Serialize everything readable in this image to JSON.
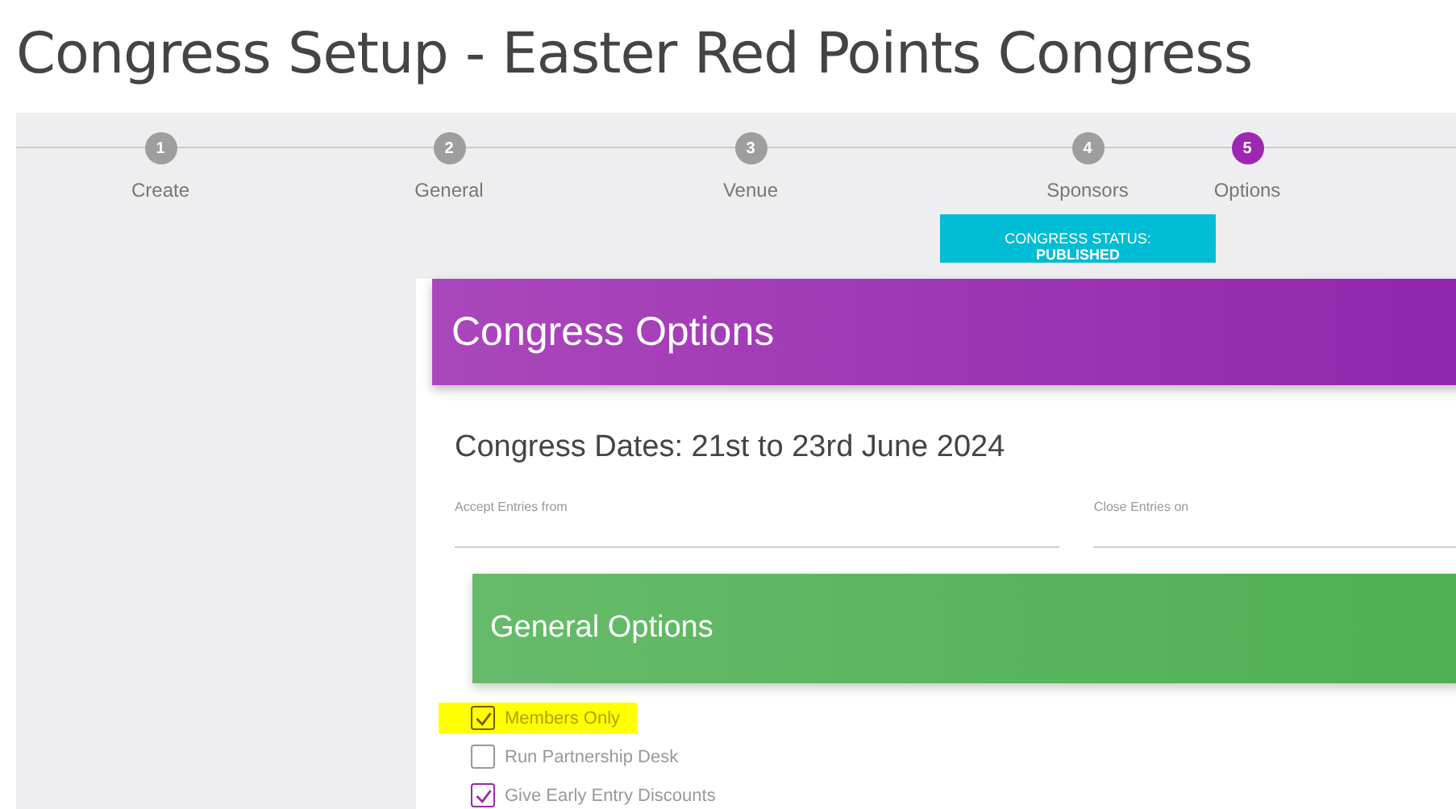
{
  "page_title": "Congress Setup - Easter Red Points Congress",
  "steps": [
    {
      "number": "1",
      "label": "Create",
      "selected": false
    },
    {
      "number": "2",
      "label": "General",
      "selected": false
    },
    {
      "number": "3",
      "label": "Venue",
      "selected": false
    },
    {
      "number": "4",
      "label": "Sponsors",
      "selected": false
    },
    {
      "number": "5",
      "label": "Options",
      "selected": true
    }
  ],
  "status": {
    "label": "CONGRESS STATUS:",
    "value": "PUBLISHED"
  },
  "card": {
    "title": "Congress Options",
    "dates": "Congress Dates: 21st to 23rd June 2024",
    "fields": [
      {
        "placeholder": "Accept Entries from"
      },
      {
        "placeholder": "Close Entries on"
      }
    ],
    "section": {
      "title": "General Options",
      "options": [
        {
          "label": "Members Only",
          "checked": true,
          "highlighted": true
        },
        {
          "label": "Run Partnership Desk",
          "checked": false,
          "highlighted": false
        },
        {
          "label": "Give Early Entry Discounts",
          "checked": true,
          "highlighted": false
        }
      ]
    }
  }
}
